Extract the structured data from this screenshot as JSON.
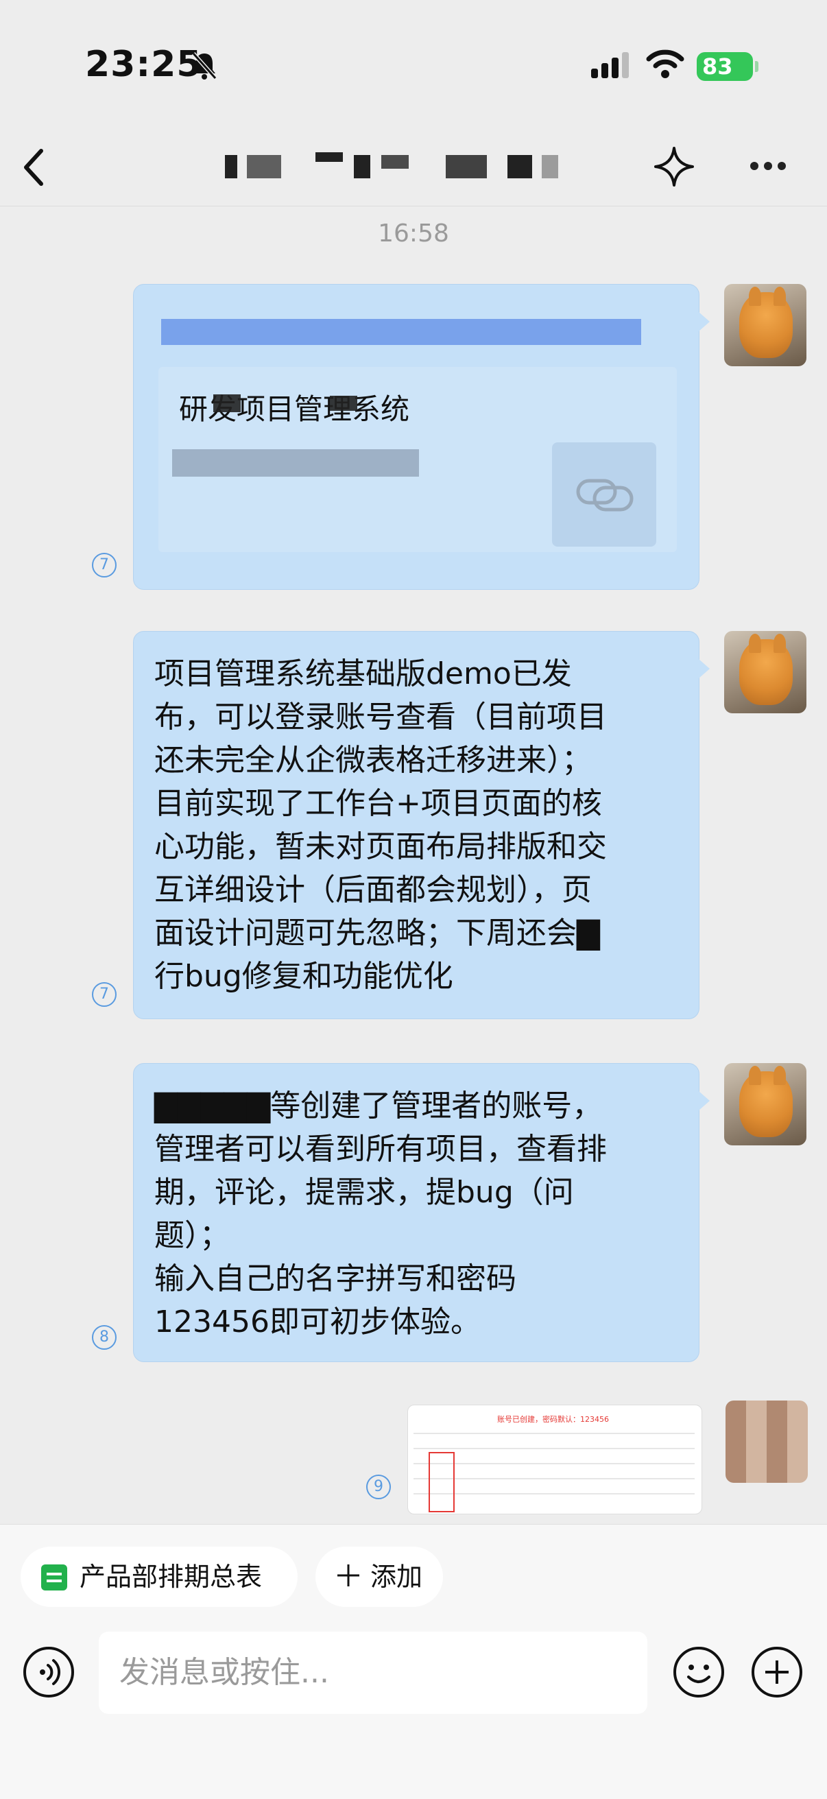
{
  "status_bar": {
    "time": "23:25",
    "battery": "83"
  },
  "nav": {
    "title_redacted": true
  },
  "chat": {
    "timestamp": "16:58",
    "messages": [
      {
        "type": "link",
        "link_title": "研发项目管理系统",
        "read_count": "7"
      },
      {
        "type": "text",
        "text": "项目管理系统基础版demo已发\n布，可以登录账号查看（目前项目\n还未完全从企微表格迁移进来）；\n目前实现了工作台+项目页面的核\n心功能，暂未对页面布局排版和交\n互详细设计（后面都会规划），页\n面设计问题可先忽略；下周还会▇\n行bug修复和功能优化",
        "read_count": "7"
      },
      {
        "type": "text",
        "text": "▇▇▇▇▇等创建了管理者的账号，\n管理者可以看到所有项目，查看排\n期，评论，提需求，提bug（问\n题）；\n输入自己的名字拼写和密码\n123456即可初步体验。",
        "read_count": "8"
      },
      {
        "type": "image",
        "image_caption": "账号已创建，密码默认：123456",
        "read_count": "9"
      }
    ]
  },
  "bottom_bar": {
    "shortcut_sheet": "产品部排期总表",
    "shortcut_add": "添加",
    "input_placeholder": "发消息或按住..."
  },
  "colors": {
    "bubble": "#c5e0f8",
    "background": "#ededed",
    "battery": "#34c759",
    "read_receipt": "#5a9be0"
  }
}
